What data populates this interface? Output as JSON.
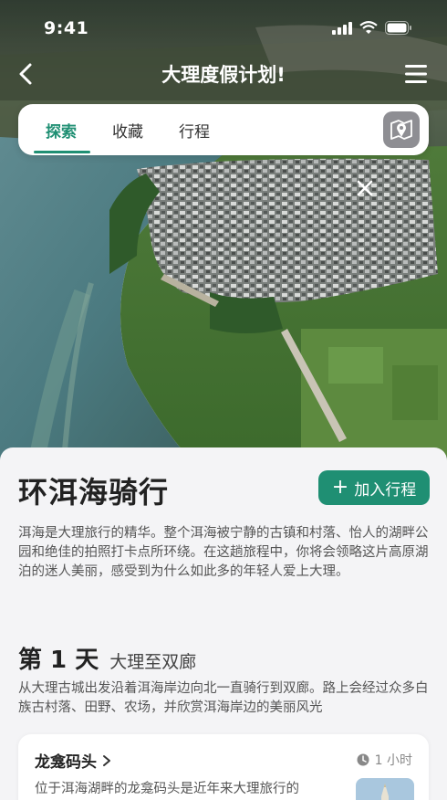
{
  "status_bar": {
    "time": "9:41",
    "icons": [
      "signal-icon",
      "wifi-icon",
      "battery-icon"
    ]
  },
  "nav": {
    "title": "大理度假计划!",
    "back_icon": "chevron-left-icon",
    "menu_icon": "hamburger-menu-icon"
  },
  "tabs": [
    {
      "label": "探索",
      "active": true
    },
    {
      "label": "收藏",
      "active": false
    },
    {
      "label": "行程",
      "active": false
    }
  ],
  "map_toggle_icon": "map-pin-icon",
  "hero_close_icon": "close-icon",
  "spot": {
    "title": "环洱海骑行",
    "add_button_label": "加入行程",
    "intro": "洱海是大理旅行的精华。整个洱海被宁静的古镇和村落、怡人的湖畔公园和绝佳的拍照打卡点所环绕。在这趟旅程中，你将会领略这片高原湖泊的迷人美丽，感受到为什么如此多的年轻人爱上大理。"
  },
  "day": {
    "label": "第 1 天",
    "route": "大理至双廊",
    "description": "从大理古城出发沿着洱海岸边向北一直骑行到双廊。路上会经过众多白族古村落、田野、农场，并欣赏洱海岸边的美丽风光"
  },
  "poi": {
    "name": "龙龛码头",
    "duration": "1 小时",
    "description": "位于洱海湖畔的龙龛码头是近年来大理旅行的"
  },
  "colors": {
    "accent": "#1f8f73",
    "background": "#f4f4f6"
  }
}
